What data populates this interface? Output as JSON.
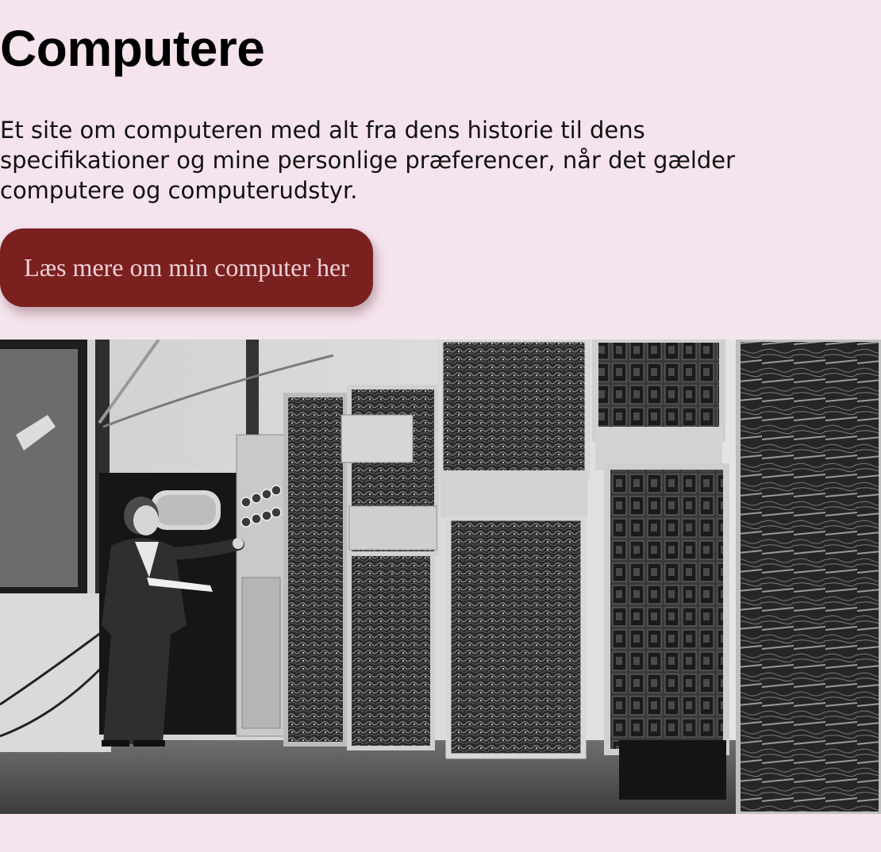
{
  "page": {
    "background": "#f5e4ee"
  },
  "hero": {
    "title": "Computere",
    "description": "Et site om computeren med alt fra dens historie til dens specifikationer og mine personlige præferencer, når det gælder computere og computerudstyr.",
    "cta_label": "Læs mere om min computer her",
    "cta_color": "#7a2120"
  },
  "image": {
    "subject": "black-and-white photo of an early mainframe computer with an operator in a suit"
  }
}
